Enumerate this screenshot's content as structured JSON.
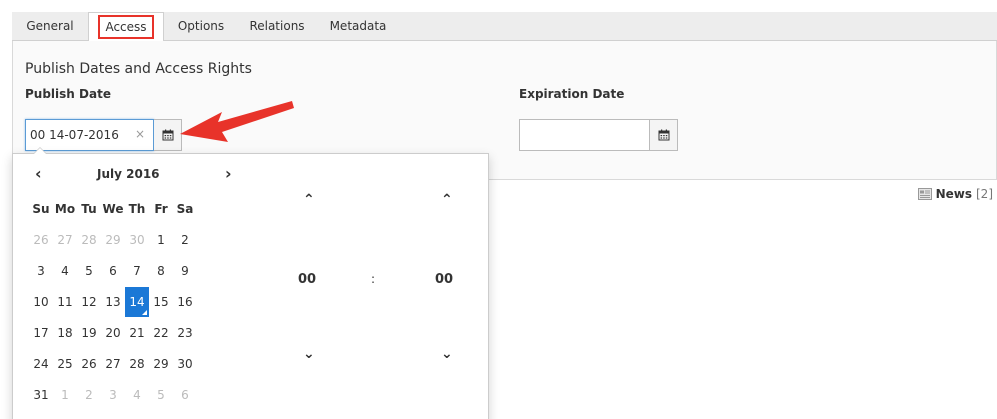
{
  "tabs": [
    "General",
    "Access",
    "Options",
    "Relations",
    "Metadata"
  ],
  "active_tab": "Access",
  "section_title": "Publish Dates and Access Rights",
  "publish": {
    "label": "Publish Date",
    "value": "00 14-07-2016",
    "clear": "×"
  },
  "expiration": {
    "label": "Expiration Date",
    "value": ""
  },
  "news": {
    "label": "News",
    "count": "[2]"
  },
  "calendar": {
    "prev": "‹",
    "next": "›",
    "month": "July 2016",
    "weekdays": [
      "Su",
      "Mo",
      "Tu",
      "We",
      "Th",
      "Fr",
      "Sa"
    ],
    "weeks": [
      [
        {
          "d": "26",
          "m": true
        },
        {
          "d": "27",
          "m": true
        },
        {
          "d": "28",
          "m": true
        },
        {
          "d": "29",
          "m": true
        },
        {
          "d": "30",
          "m": true
        },
        {
          "d": "1"
        },
        {
          "d": "2"
        }
      ],
      [
        {
          "d": "3"
        },
        {
          "d": "4"
        },
        {
          "d": "5"
        },
        {
          "d": "6"
        },
        {
          "d": "7"
        },
        {
          "d": "8"
        },
        {
          "d": "9"
        }
      ],
      [
        {
          "d": "10"
        },
        {
          "d": "11"
        },
        {
          "d": "12"
        },
        {
          "d": "13"
        },
        {
          "d": "14",
          "s": true
        },
        {
          "d": "15"
        },
        {
          "d": "16"
        }
      ],
      [
        {
          "d": "17"
        },
        {
          "d": "18"
        },
        {
          "d": "19"
        },
        {
          "d": "20"
        },
        {
          "d": "21"
        },
        {
          "d": "22"
        },
        {
          "d": "23"
        }
      ],
      [
        {
          "d": "24"
        },
        {
          "d": "25"
        },
        {
          "d": "26"
        },
        {
          "d": "27"
        },
        {
          "d": "28"
        },
        {
          "d": "29"
        },
        {
          "d": "30"
        }
      ],
      [
        {
          "d": "31"
        },
        {
          "d": "1",
          "m": true
        },
        {
          "d": "2",
          "m": true
        },
        {
          "d": "3",
          "m": true
        },
        {
          "d": "4",
          "m": true
        },
        {
          "d": "5",
          "m": true
        },
        {
          "d": "6",
          "m": true
        }
      ]
    ]
  },
  "time": {
    "hours": "00",
    "separator": ":",
    "minutes": "00"
  },
  "colors": {
    "selected_day": "#1b78d6",
    "highlight_box": "#e8332a",
    "arrow": "#e8332a"
  }
}
